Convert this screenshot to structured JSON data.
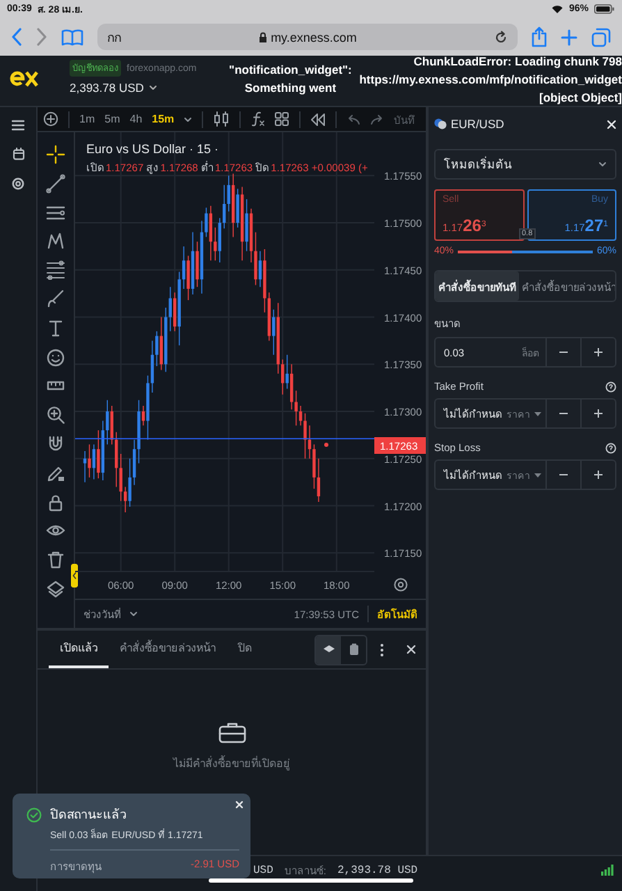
{
  "status_bar": {
    "time": "00:39",
    "date": "ส. 28 เม.ย.",
    "battery": "96%"
  },
  "browser": {
    "reader_button": "กก",
    "url": "my.exness.com"
  },
  "app_header": {
    "account_badge": "บัญชีทดลอง",
    "server": "forexonapp.com",
    "balance": "2,393.78 USD"
  },
  "error_messages": [
    {
      "lines": [
        "\"notification_widget\":",
        "Something went"
      ]
    },
    {
      "lines": [
        "ChunkLoadError: Loading chunk 798",
        "https://my.exness.com/mfp/notification_widget",
        "[object Object]"
      ]
    }
  ],
  "chart_toolbar": {
    "timeframes": [
      {
        "label": "1m",
        "selected": false
      },
      {
        "label": "5m",
        "selected": false
      },
      {
        "label": "4h",
        "selected": false
      },
      {
        "label": "15m",
        "selected": true
      }
    ],
    "save_label": "บันทึ"
  },
  "chart": {
    "title": "Euro vs US Dollar · 15 ·",
    "ohlc": [
      {
        "label": "เปิด",
        "value": "1.17267"
      },
      {
        "label": "สูง",
        "value": "1.17268"
      },
      {
        "label": "ต่ำ",
        "value": "1.17263"
      },
      {
        "label": "ปิด",
        "value": "1.17263"
      }
    ],
    "change": "+0.00039 (+",
    "current_price": "1.17263",
    "chart_data": {
      "type": "candlestick",
      "x": [
        4,
        4.25,
        4.5,
        4.75,
        5,
        5.25,
        5.5,
        5.75,
        6,
        6.25,
        6.5,
        6.75,
        7,
        7.25,
        7.5,
        7.75,
        8,
        8.25,
        8.5,
        8.75,
        9,
        9.25,
        9.5,
        9.75,
        10,
        10.25,
        10.5,
        10.75,
        11,
        11.25,
        11.5,
        11.75,
        12,
        12.25,
        12.5,
        12.75,
        13,
        13.25,
        13.5,
        13.75,
        14,
        14.25,
        14.5,
        14.75,
        15,
        15.25,
        15.5,
        15.75,
        16,
        16.25,
        16.5,
        16.75,
        17
      ],
      "ohlc": [
        [
          1.17245,
          1.17258,
          1.17225,
          1.1725
        ],
        [
          1.1725,
          1.17265,
          1.1723,
          1.1724
        ],
        [
          1.1724,
          1.17265,
          1.17228,
          1.1726
        ],
        [
          1.1726,
          1.1728,
          1.17229,
          1.17235
        ],
        [
          1.17235,
          1.1729,
          1.17227,
          1.1728
        ],
        [
          1.1728,
          1.17312,
          1.17265,
          1.173
        ],
        [
          1.173,
          1.17306,
          1.17265,
          1.1727
        ],
        [
          1.1727,
          1.17278,
          1.1722,
          1.1724
        ],
        [
          1.1724,
          1.17255,
          1.17205,
          1.17215
        ],
        [
          1.17215,
          1.1722,
          1.17193,
          1.17205
        ],
        [
          1.17205,
          1.1725,
          1.17199,
          1.1723
        ],
        [
          1.1723,
          1.1727,
          1.17222,
          1.1726
        ],
        [
          1.1726,
          1.17312,
          1.17245,
          1.173
        ],
        [
          1.173,
          1.17306,
          1.17285,
          1.1729
        ],
        [
          1.1729,
          1.17338,
          1.1727,
          1.1733
        ],
        [
          1.1733,
          1.17375,
          1.1732,
          1.1736
        ],
        [
          1.1736,
          1.17385,
          1.17348,
          1.1738
        ],
        [
          1.1738,
          1.174,
          1.17344,
          1.1735
        ],
        [
          1.1735,
          1.1741,
          1.17342,
          1.174
        ],
        [
          1.174,
          1.17432,
          1.17385,
          1.1742
        ],
        [
          1.1742,
          1.17426,
          1.17385,
          1.1739
        ],
        [
          1.1739,
          1.17448,
          1.1737,
          1.1744
        ],
        [
          1.1744,
          1.17475,
          1.1743,
          1.1746
        ],
        [
          1.1746,
          1.17465,
          1.17418,
          1.1743
        ],
        [
          1.1743,
          1.1749,
          1.17424,
          1.1747
        ],
        [
          1.1747,
          1.1748,
          1.17432,
          1.1744
        ],
        [
          1.1744,
          1.17502,
          1.17425,
          1.1749
        ],
        [
          1.1749,
          1.17516,
          1.17485,
          1.1751
        ],
        [
          1.1751,
          1.17518,
          1.1746,
          1.1748
        ],
        [
          1.1748,
          1.17495,
          1.1746,
          1.1747
        ],
        [
          1.1747,
          1.17505,
          1.17458,
          1.175
        ],
        [
          1.175,
          1.1754,
          1.17494,
          1.1752
        ],
        [
          1.1752,
          1.1755,
          1.17512,
          1.1754
        ],
        [
          1.1754,
          1.17552,
          1.17485,
          1.175
        ],
        [
          1.175,
          1.17536,
          1.17495,
          1.1753
        ],
        [
          1.1753,
          1.17538,
          1.1746,
          1.1748
        ],
        [
          1.1748,
          1.17525,
          1.1747,
          1.1751
        ],
        [
          1.1751,
          1.17515,
          1.17458,
          1.1747
        ],
        [
          1.1747,
          1.1749,
          1.17434,
          1.1744
        ],
        [
          1.1744,
          1.1747,
          1.17432,
          1.1746
        ],
        [
          1.1746,
          1.17472,
          1.17405,
          1.1742
        ],
        [
          1.1742,
          1.17426,
          1.17375,
          1.1738
        ],
        [
          1.1738,
          1.17408,
          1.1736,
          1.174
        ],
        [
          1.174,
          1.17415,
          1.1734,
          1.1735
        ],
        [
          1.1735,
          1.17355,
          1.17318,
          1.1733
        ],
        [
          1.1733,
          1.1736,
          1.17324,
          1.1734
        ],
        [
          1.1734,
          1.1735,
          1.17302,
          1.1731
        ],
        [
          1.1731,
          1.17322,
          1.17285,
          1.173
        ],
        [
          1.173,
          1.17306,
          1.17285,
          1.1729
        ],
        [
          1.1729,
          1.17298,
          1.1725,
          1.1727
        ],
        [
          1.1727,
          1.17285,
          1.1725,
          1.1726
        ],
        [
          1.1726,
          1.17265,
          1.17218,
          1.1723
        ],
        [
          1.1723,
          1.1725,
          1.17204,
          1.1721
        ]
      ],
      "ylim": [
        1.17131,
        1.17596
      ],
      "xlim": [
        3.4575,
        20.1
      ],
      "grid": true,
      "ref_lines": [
        {
          "axis": "y",
          "value": 1.17271,
          "color": "#2962ff"
        }
      ],
      "yticks": [
        {
          "value": 1.1755,
          "label": "1.17550"
        },
        {
          "value": 1.175,
          "label": "1.17500"
        },
        {
          "value": 1.1745,
          "label": "1.17450"
        },
        {
          "value": 1.174,
          "label": "1.17400"
        },
        {
          "value": 1.1735,
          "label": "1.17350"
        },
        {
          "value": 1.173,
          "label": "1.17300"
        },
        {
          "value": 1.1725,
          "label": "1.17250"
        },
        {
          "value": 1.172,
          "label": "1.17200"
        },
        {
          "value": 1.1715,
          "label": "1.17150"
        }
      ],
      "xticks": [
        {
          "value": 6,
          "label": "06:00"
        },
        {
          "value": 9,
          "label": "09:00"
        },
        {
          "value": 12,
          "label": "12:00"
        },
        {
          "value": 15,
          "label": "15:00"
        },
        {
          "value": 18,
          "label": "18:00"
        }
      ]
    }
  },
  "chart_footer": {
    "range": "ช่วงวันที่",
    "time": "17:39:53 UTC",
    "scale": "อัตโนมัติ"
  },
  "order_panel": {
    "symbol": "EUR/USD",
    "mode": "โหมดเริ่มต้น",
    "sell": {
      "label": "Sell",
      "price_head": "1.17",
      "price_big": "26",
      "price_tail": "3"
    },
    "buy": {
      "label": "Buy",
      "price_head": "1.17",
      "price_big": "27",
      "price_tail": "1"
    },
    "spread": "0.8",
    "sell_share": "40%",
    "buy_share": "60%",
    "level": 0.4,
    "order_types": [
      {
        "label": "คำสั่งซื้อขายทันที",
        "selected": true
      },
      {
        "label": "คำสั่งซื้อขายล่วงหน้า",
        "selected": false
      }
    ],
    "fields": [
      {
        "kind": "volume",
        "label": "ขนาด",
        "value": "0.03",
        "unit": "ล็อต"
      },
      {
        "kind": "price",
        "label": "Take Profit",
        "value": "ไม่ได้กำหนด",
        "unit": "ราคา"
      },
      {
        "kind": "price",
        "label": "Stop Loss",
        "value": "ไม่ได้กำหนด",
        "unit": "ราคา"
      }
    ]
  },
  "positions": {
    "tabs": [
      {
        "label": "เปิดแล้ว",
        "selected": true
      },
      {
        "label": "คำสั่งซื้อขายล่วงหน้า",
        "selected": false
      },
      {
        "label": "ปิด",
        "selected": false
      }
    ],
    "empty_message": "ไม่มีคำสั่งซื้อขายที่เปิดอยู่"
  },
  "footer": {
    "currency": "USD",
    "balance_label": "บาลานซ์:",
    "balance": "2,393.78 USD"
  },
  "toast": {
    "title": "ปิดสถานะแล้ว",
    "detail": "Sell 0.03 ล็อต EUR/USD ที่ 1.17271",
    "result_label": "การขาดทุน",
    "result_value": "-2.91 USD"
  }
}
